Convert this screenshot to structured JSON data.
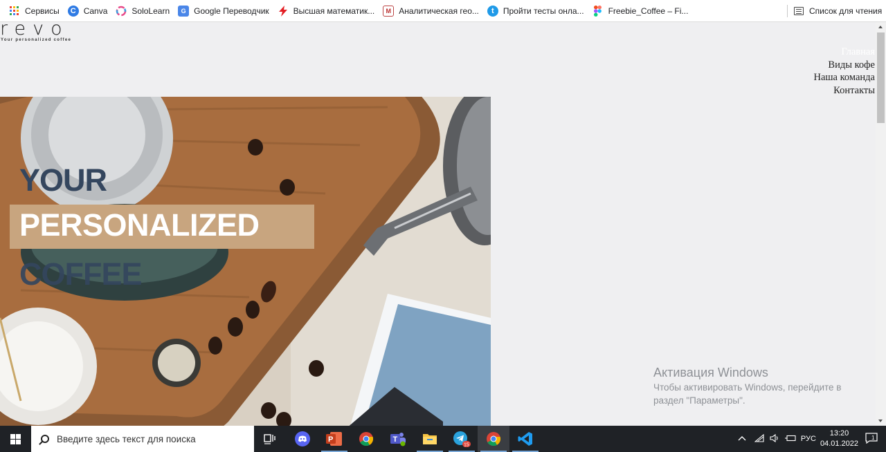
{
  "bookmarks": [
    {
      "label": "Сервисы",
      "icon": "apps-grid-icon"
    },
    {
      "label": "Canva",
      "icon": "canva-icon"
    },
    {
      "label": "SoloLearn",
      "icon": "sololearn-icon"
    },
    {
      "label": "Google Переводчик",
      "icon": "google-translate-icon"
    },
    {
      "label": "Высшая математик...",
      "icon": "lightning-icon"
    },
    {
      "label": "Аналитическая гео...",
      "icon": "site-icon"
    },
    {
      "label": "Пройти тесты онла...",
      "icon": "test-site-icon"
    },
    {
      "label": "Freebie_Coffee – Fi...",
      "icon": "figma-icon"
    }
  ],
  "reading_list": {
    "label": "Список для чтения",
    "icon": "reading-list-icon"
  },
  "site": {
    "logo": "revo",
    "tagline": "Your personalized coffee",
    "nav": [
      {
        "label": "Главная",
        "active": true
      },
      {
        "label": "Виды кофе",
        "active": false
      },
      {
        "label": "Наша команда",
        "active": false
      },
      {
        "label": "Контакты",
        "active": false
      }
    ],
    "hero": {
      "line1": "YOUR",
      "line2": "PERSONALIZED",
      "line3": "COFFEE"
    }
  },
  "activation": {
    "title": "Активация Windows",
    "text": "Чтобы активировать Windows, перейдите в раздел \"Параметры\"."
  },
  "taskbar": {
    "search_placeholder": "Введите здесь текст для поиска",
    "apps": [
      "task-view-icon",
      "discord-icon",
      "powerpoint-icon",
      "chrome-icon",
      "teams-icon",
      "file-explorer-icon",
      "telegram-icon",
      "chrome-icon",
      "vscode-icon"
    ],
    "telegram_badge": "15",
    "language": "РУС",
    "time": "13:20",
    "date": "04.01.2022",
    "notifications": "1"
  },
  "colors": {
    "hero_dark_text": "#34465e",
    "hero_band": "#c8a57f",
    "page_bg": "#efeff1",
    "taskbar": "#1f2226"
  }
}
